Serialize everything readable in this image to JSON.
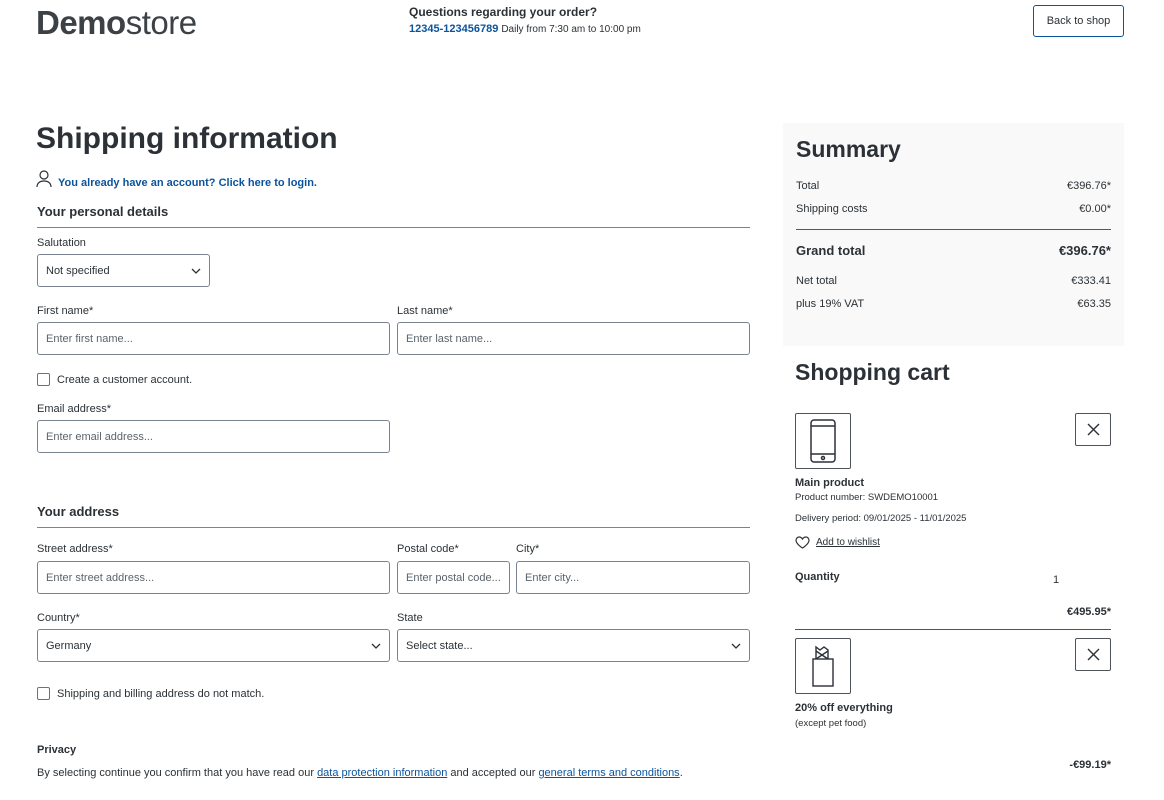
{
  "header": {
    "logo_bold": "Demo",
    "logo_light": "store",
    "hotline_question": "Questions regarding your order?",
    "hotline_phone": "12345-123456789",
    "hotline_hours": "Daily from 7:30 am to 10:00 pm",
    "back_button": "Back to shop"
  },
  "page": {
    "title": "Shipping information",
    "login_link": "You already have an account? Click here to login."
  },
  "personal": {
    "section_title": "Your personal details",
    "salutation_label": "Salutation",
    "salutation_value": "Not specified",
    "first_name_label": "First name*",
    "first_name_placeholder": "Enter first name...",
    "last_name_label": "Last name*",
    "last_name_placeholder": "Enter last name...",
    "create_account_label": "Create a customer account.",
    "email_label": "Email address*",
    "email_placeholder": "Enter email address..."
  },
  "address": {
    "section_title": "Your address",
    "street_label": "Street address*",
    "street_placeholder": "Enter street address...",
    "postal_label": "Postal code*",
    "postal_placeholder": "Enter postal code...",
    "city_label": "City*",
    "city_placeholder": "Enter city...",
    "country_label": "Country*",
    "country_value": "Germany",
    "state_label": "State",
    "state_value": "Select state...",
    "different_billing_label": "Shipping and billing address do not match."
  },
  "privacy": {
    "title": "Privacy",
    "text_before": "By selecting continue you confirm that you have read our ",
    "link_data_protection": "data protection information",
    "text_middle": " and accepted our ",
    "link_terms": "general terms and conditions",
    "text_after": "."
  },
  "summary": {
    "title": "Summary",
    "total_label": "Total",
    "total_value": "€396.76*",
    "shipping_label": "Shipping costs",
    "shipping_value": "€0.00*",
    "grand_label": "Grand total",
    "grand_value": "€396.76*",
    "net_label": "Net total",
    "net_value": "€333.41",
    "vat_label": "plus 19% VAT",
    "vat_value": "€63.35"
  },
  "cart": {
    "title": "Shopping cart",
    "items": [
      {
        "name": "Main product",
        "product_number": "Product number: SWDEMO10001",
        "delivery": "Delivery period: 09/01/2025 - 11/01/2025",
        "wishlist": "Add to wishlist",
        "quantity_label": "Quantity",
        "quantity": "1",
        "price": "€495.95*",
        "icon": "smartphone-icon"
      },
      {
        "name": "20% off everything",
        "note": "(except pet food)",
        "price": "-€99.19*",
        "icon": "discount-voucher-icon"
      }
    ]
  }
}
